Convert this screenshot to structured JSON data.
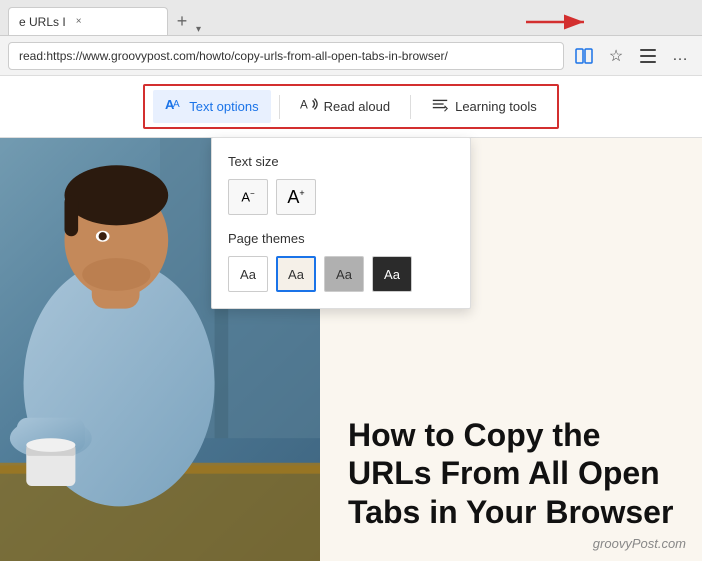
{
  "browser": {
    "tab": {
      "title": "e URLs I",
      "close_icon": "×"
    },
    "add_tab_icon": "+",
    "chevron_icon": "▾",
    "address": {
      "full": "read:https://www.groovypost.com/howto/copy-urls-from-all-open-tabs-in-browser/",
      "display": "read:https://www.groovypost.com/howto/copy-urls-from-all-open-tabs-in-browser/"
    },
    "toolbar_icons": {
      "reader_icon": "⊞",
      "star_icon": "☆",
      "hub_icon": "≡",
      "more_icon": "…"
    }
  },
  "reader_toolbar": {
    "text_options_label": "Text options",
    "read_aloud_label": "Read aloud",
    "learning_tools_label": "Learning tools"
  },
  "text_options_panel": {
    "text_size_title": "Text size",
    "decrease_label": "A",
    "increase_label": "A",
    "page_themes_title": "Page themes",
    "themes": [
      {
        "label": "Aa",
        "name": "white"
      },
      {
        "label": "Aa",
        "name": "light",
        "selected": true
      },
      {
        "label": "Aa",
        "name": "gray"
      },
      {
        "label": "Aa",
        "name": "dark"
      }
    ]
  },
  "article": {
    "title": "How to Copy the URLs From All Open Tabs in Your Browser"
  },
  "watermark": {
    "text": "groovyPost.com"
  }
}
